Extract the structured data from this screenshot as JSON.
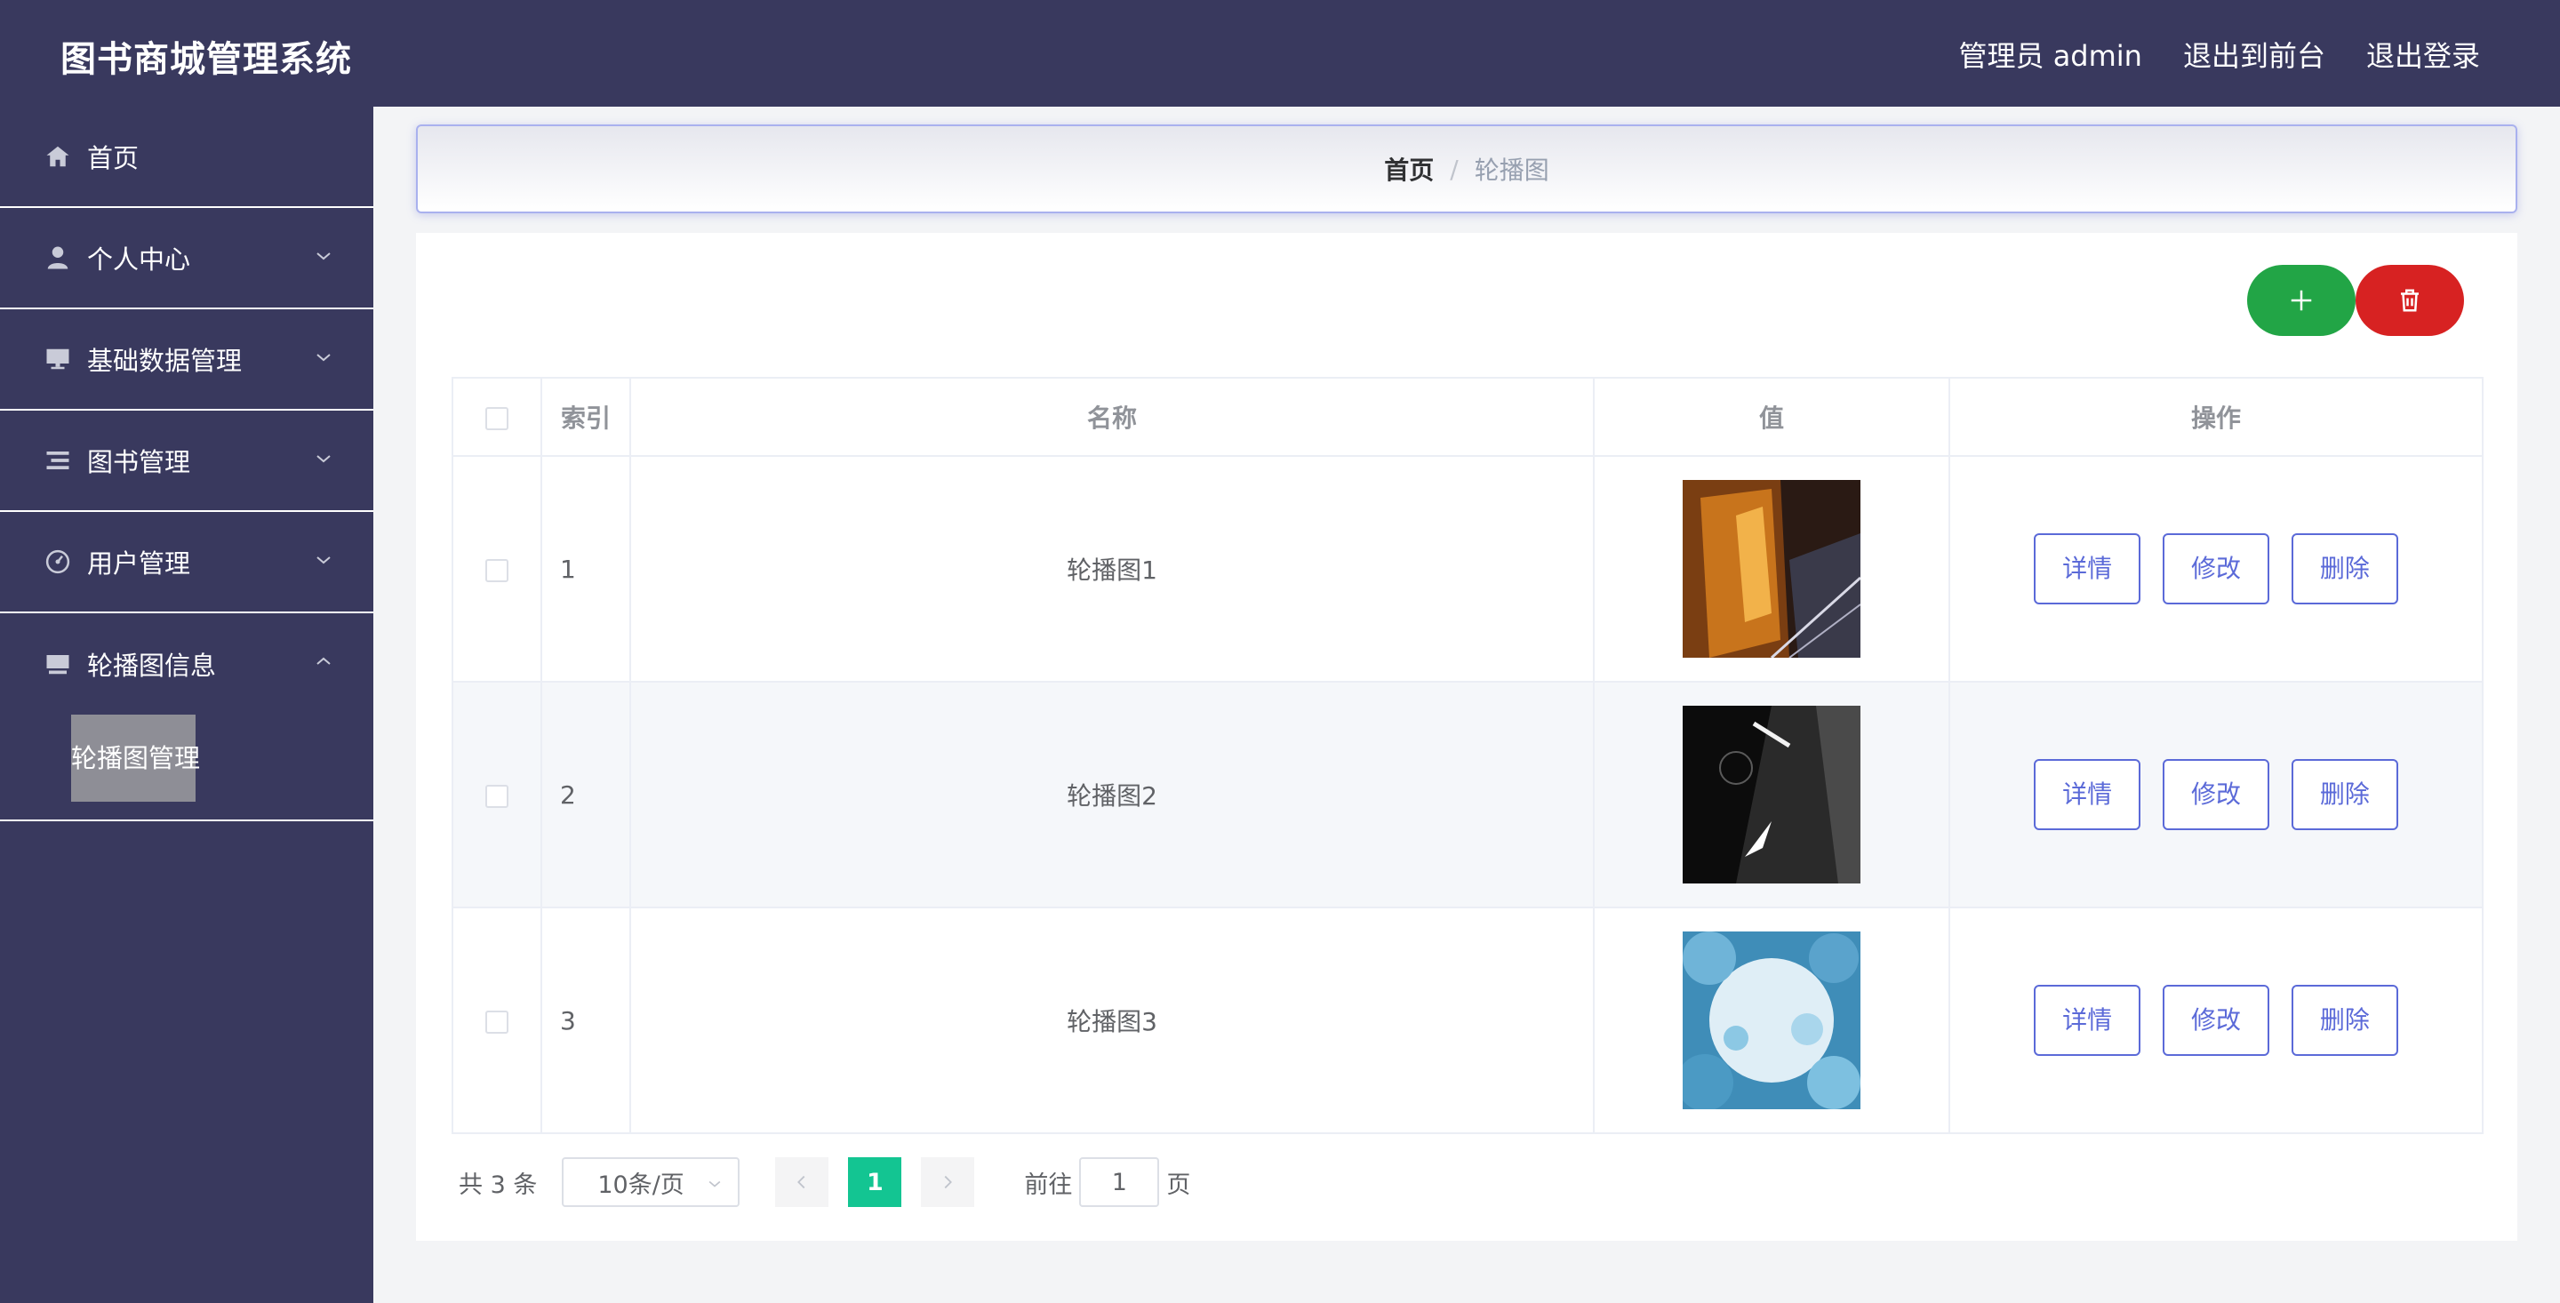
{
  "header": {
    "title": "图书商城管理系统",
    "nav": [
      "管理员 admin",
      "退出到前台",
      "退出登录"
    ]
  },
  "sidebar": {
    "items": [
      {
        "label": "首页",
        "icon": "home-icon"
      },
      {
        "label": "个人中心",
        "icon": "user-icon"
      },
      {
        "label": "基础数据管理",
        "icon": "monitor-icon"
      },
      {
        "label": "图书管理",
        "icon": "list-icon"
      },
      {
        "label": "用户管理",
        "icon": "gauge-icon"
      },
      {
        "label": "轮播图信息",
        "icon": "image-stack-icon",
        "expanded": true,
        "children": [
          "轮播图管理"
        ]
      }
    ]
  },
  "breadcrumb": {
    "home": "首页",
    "separator": "/",
    "current": "轮播图"
  },
  "table": {
    "columns": [
      "索引",
      "名称",
      "值",
      "操作"
    ],
    "rows": [
      {
        "index": "1",
        "name": "轮播图1"
      },
      {
        "index": "2",
        "name": "轮播图2"
      },
      {
        "index": "3",
        "name": "轮播图3"
      }
    ],
    "actions": [
      "详情",
      "修改",
      "删除"
    ]
  },
  "pagination": {
    "total": "共 3 条",
    "page_size": "10条/页",
    "current_page": "1",
    "goto_label": "前往",
    "goto_value": "1",
    "page_suffix": "页"
  },
  "colors": {
    "sidebar_bg": "#39395e",
    "add_button": "#22a546",
    "delete_button": "#d72222",
    "action_button": "#5b6ad8",
    "active_page": "#13c592"
  }
}
